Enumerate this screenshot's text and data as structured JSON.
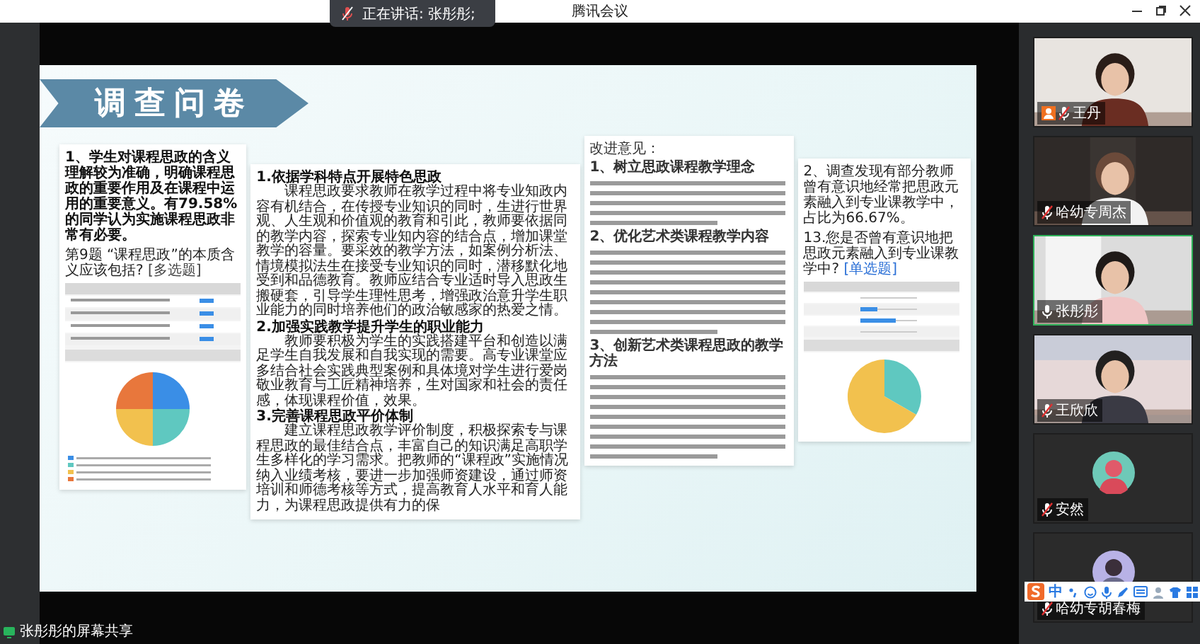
{
  "window": {
    "title": "腾讯会议"
  },
  "speaking_banner": {
    "text": "正在讲话: 张彤彤;"
  },
  "slide": {
    "title": "调查问卷",
    "doc_1": {
      "heading": "1、学生对课程思政的含义理解较为准确，明确课程思政的重要作用及在课程中运用的重要意义。有79.58%的同学认为实施课程思政非常有必要。",
      "question": "第9题 “课程思政”的本质含义应该包括?",
      "question_type": "[多选题]"
    },
    "doc_2": {
      "sections": [
        {
          "heading": "1.依据学科特点开展特色思政",
          "body": "课程思政要求教师在教学过程中将专业知政内容有机结合，在传授专业知识的同时，生进行世界观、人生观和价值观的教育和引此，教师要依据同的教学内容，探索专业知内容的结合点，增加课堂教学的容量。要采效的教学方法，如案例分析法、情境模拟法生在接受专业知识的同时，潜移默化地受到和品德教育。教师应结合专业适时导入思政生搬硬套，引导学生理性思考，增强政治意升学生职业能力的同时培养他们的政治敏感家的热爱之情。"
        },
        {
          "heading": "2.加强实践教学提升学生的职业能力",
          "body": "教师要积极为学生的实践搭建平台和创造以满足学生自我发展和自我实现的需要。高专业课堂应多结合社会实践典型案例和具体境对学生进行爱岗敬业教育与工匠精神培养，生对国家和社会的责任感，体现课程价值，效果。"
        },
        {
          "heading": "3.完善课程思政平价体制",
          "body": "建立课程思政教学评价制度，积极探索专与课程思政的最佳结合点，丰富自己的知识满足高职学生多样化的学习需求。把教师的“课程政”实施情况纳入业绩考核，要进一步加强师资建设，通过师资培训和师德考核等方式，提高教育人水平和育人能力，为课程思政提供有力的保"
        }
      ]
    },
    "doc_3": {
      "title": "改进意见：",
      "sections": [
        {
          "heading": "1、树立思政课程教学理念"
        },
        {
          "heading": "2、优化艺术类课程教学内容"
        },
        {
          "heading": "3、创新艺术类课程思政的教学方法"
        }
      ]
    },
    "doc_4": {
      "finding": "2、调查发现有部分教师曾有意识地经常把思政元素融入到专业课教学中，占比为66.67%。",
      "question": "13.您是否曾有意识地把思政元素融入到专业课教学中?",
      "question_type": "[单选题]"
    }
  },
  "participants": [
    {
      "name": "王丹",
      "kind": "video",
      "host": true,
      "speaking": false,
      "muted": true
    },
    {
      "name": "哈幼专周杰",
      "kind": "video",
      "host": false,
      "speaking": false,
      "muted": true
    },
    {
      "name": "张彤彤",
      "kind": "video",
      "host": false,
      "speaking": true,
      "muted": false
    },
    {
      "name": "王欣欣",
      "kind": "video",
      "host": false,
      "speaking": false,
      "muted": true
    },
    {
      "name": "安然",
      "kind": "avatar",
      "host": false,
      "speaking": false,
      "muted": true
    },
    {
      "name": "哈幼专胡春梅",
      "kind": "avatar",
      "host": false,
      "speaking": false,
      "muted": true
    }
  ],
  "share_label": "张彤彤的屏幕共享",
  "ime_toolbar": {
    "mode": "中"
  }
}
